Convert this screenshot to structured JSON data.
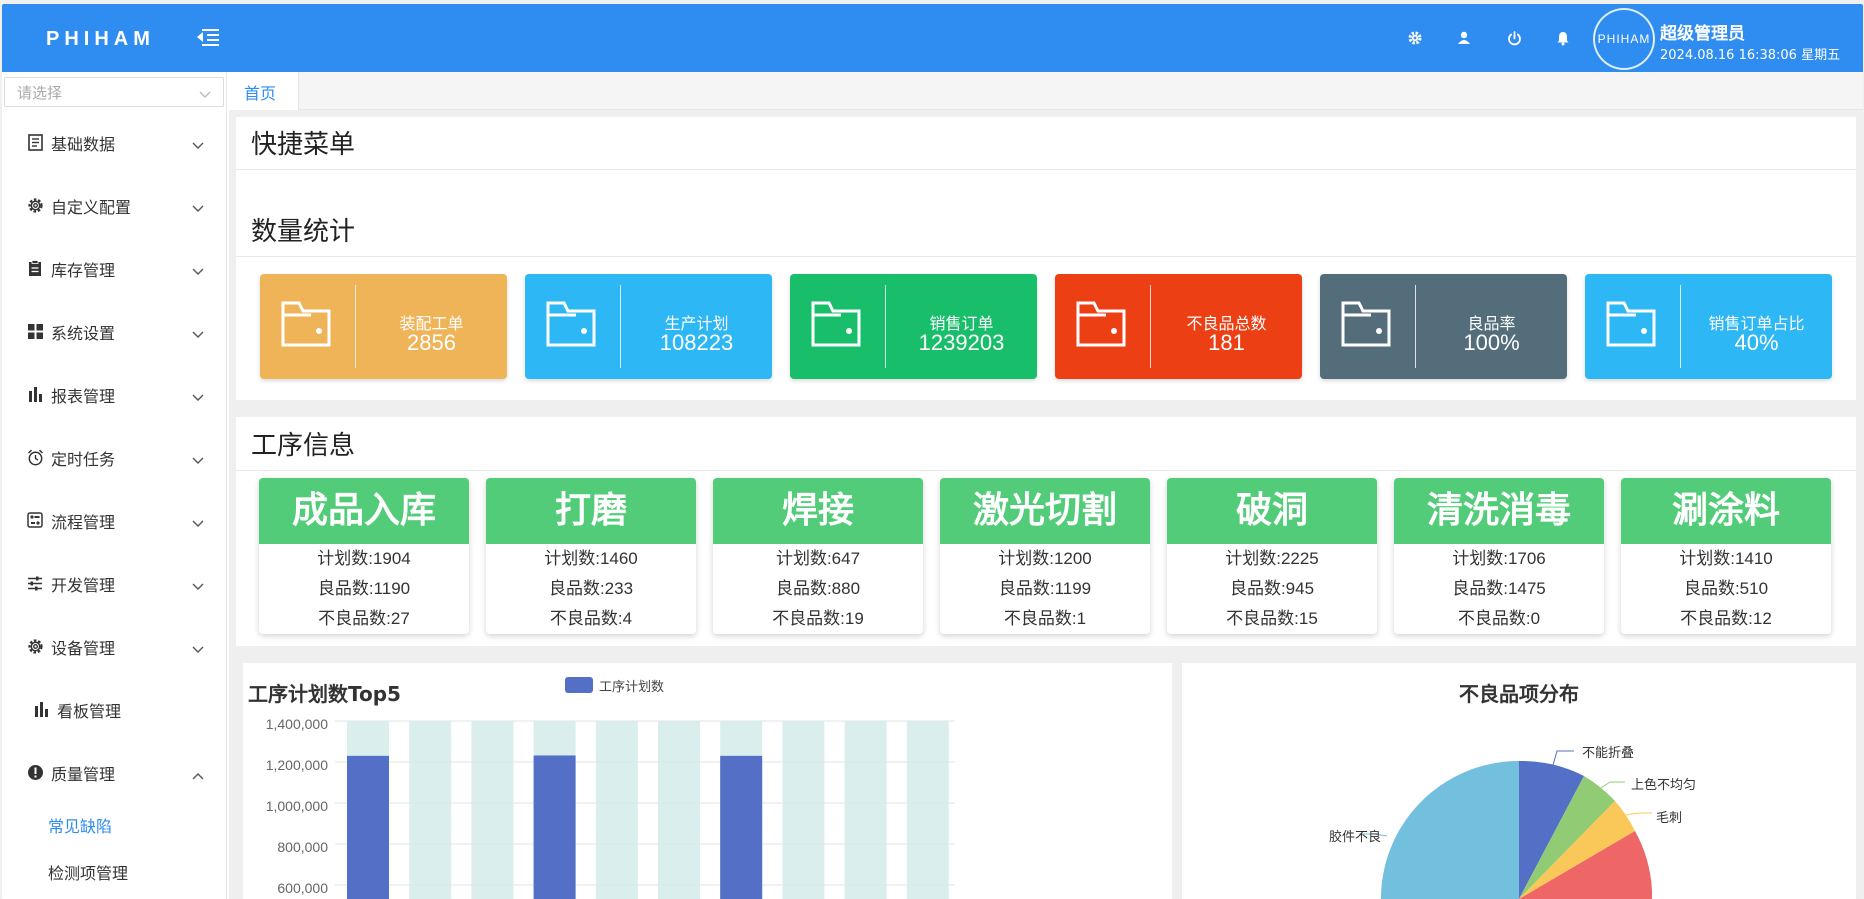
{
  "header": {
    "logo": "PHIHAM",
    "avatar_text": "PHIHAM",
    "username": "超级管理员",
    "datetime": "2024.08.16 16:38:06 星期五",
    "bg_color": "#2f8cf0"
  },
  "sidebar": {
    "select_placeholder": "请选择",
    "items": [
      {
        "label": "基础数据",
        "icon": "document-icon"
      },
      {
        "label": "自定义配置",
        "icon": "gear-icon"
      },
      {
        "label": "库存管理",
        "icon": "clipboard-icon"
      },
      {
        "label": "系统设置",
        "icon": "grid-icon"
      },
      {
        "label": "报表管理",
        "icon": "bar-chart-icon"
      },
      {
        "label": "定时任务",
        "icon": "alarm-clock-icon"
      },
      {
        "label": "流程管理",
        "icon": "flow-icon"
      },
      {
        "label": "开发管理",
        "icon": "sliders-icon"
      },
      {
        "label": "设备管理",
        "icon": "gear-icon"
      },
      {
        "label": "看板管理",
        "icon": "bar-chart-icon"
      },
      {
        "label": "质量管理",
        "icon": "alert-icon"
      }
    ],
    "subitems": [
      {
        "label": "常见缺陷",
        "active": true
      },
      {
        "label": "检测项管理",
        "active": false
      }
    ]
  },
  "tabs": [
    {
      "label": "首页"
    }
  ],
  "sections": {
    "shortcut_title": "快捷菜单",
    "stats_title": "数量统计",
    "process_title": "工序信息"
  },
  "stats": [
    {
      "label": "装配工单",
      "value": "2856",
      "color": "#f0b458"
    },
    {
      "label": "生产计划",
      "value": "108223",
      "color": "#2db7f5"
    },
    {
      "label": "销售订单",
      "value": "1239203",
      "color": "#19be6b"
    },
    {
      "label": "不良品总数",
      "value": "181",
      "color": "#ed3f14"
    },
    {
      "label": "良品率",
      "value": "100%",
      "color": "#546d7a"
    },
    {
      "label": "销售订单占比",
      "value": "40%",
      "color": "#2db7f5"
    }
  ],
  "processes": [
    {
      "name": "成品入库",
      "plan": "计划数:1904",
      "good": "良品数:1190",
      "bad": "不良品数:27"
    },
    {
      "name": "打磨",
      "plan": "计划数:1460",
      "good": "良品数:233",
      "bad": "不良品数:4"
    },
    {
      "name": "焊接",
      "plan": "计划数:647",
      "good": "良品数:880",
      "bad": "不良品数:19"
    },
    {
      "name": "激光切割",
      "plan": "计划数:1200",
      "good": "良品数:1199",
      "bad": "不良品数:1"
    },
    {
      "name": "破洞",
      "plan": "计划数:2225",
      "good": "良品数:945",
      "bad": "不良品数:15"
    },
    {
      "name": "清洗消毒",
      "plan": "计划数:1706",
      "good": "良品数:1475",
      "bad": "不良品数:0"
    },
    {
      "name": "涮涂料",
      "plan": "计划数:1410",
      "good": "良品数:510",
      "bad": "不良品数:12"
    }
  ],
  "chart_data": [
    {
      "type": "bar",
      "title": "工序计划数Top5",
      "legend": [
        "工序计划数"
      ],
      "legend_position": "top",
      "series": [
        {
          "name": "工序计划数",
          "values": [
            1230000,
            1232000,
            1230000
          ],
          "color": "#5470c6"
        }
      ],
      "y_ticks": [
        "1,400,000",
        "1,200,000",
        "1,000,000",
        "800,000",
        "600,000"
      ],
      "ylim": [
        600000,
        1400000
      ],
      "grid": true
    },
    {
      "type": "pie",
      "title": "不良品项分布",
      "labels": [
        "不能折叠",
        "上色不均匀",
        "毛刺",
        "胶件不良"
      ],
      "colors": [
        "#5470c6",
        "#91cc75",
        "#fac858",
        "#ee6666",
        "#73c0de"
      ]
    }
  ]
}
